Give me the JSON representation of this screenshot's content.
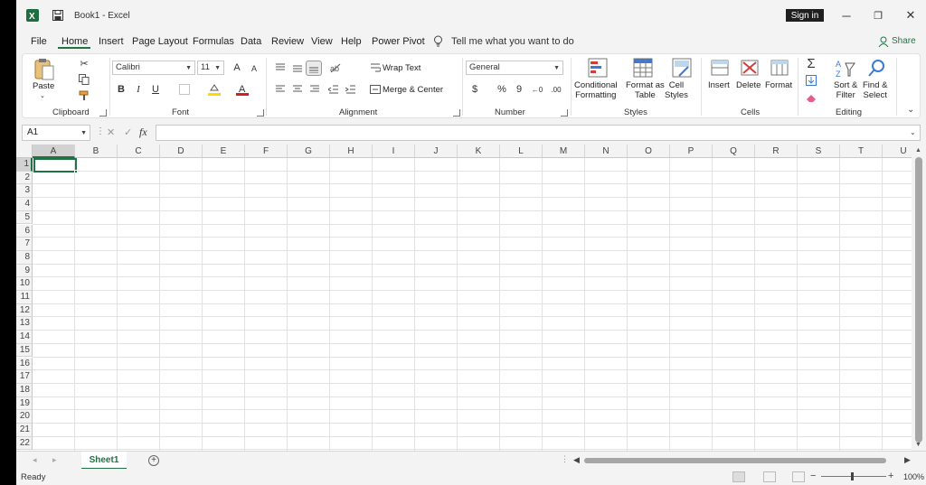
{
  "window": {
    "title": "Book1  -  Excel",
    "signin": "Sign in",
    "minimize": "─",
    "restore": "❐",
    "close": "✕"
  },
  "menu": {
    "items": [
      "File",
      "Home",
      "Insert",
      "Page Layout",
      "Formulas",
      "Data",
      "Review",
      "View",
      "Help",
      "Power Pivot"
    ],
    "tell_me": "Tell me what you want to do",
    "share": "Share"
  },
  "ribbon": {
    "clipboard": {
      "paste": "Paste",
      "label": "Clipboard"
    },
    "font": {
      "name": "Calibri",
      "size": "11",
      "bold": "B",
      "italic": "I",
      "underline": "U",
      "grow": "A",
      "shrink": "A",
      "label": "Font"
    },
    "alignment": {
      "wrap": "Wrap Text",
      "merge": "Merge & Center",
      "label": "Alignment"
    },
    "number": {
      "format": "General",
      "currency": "$",
      "percent": "%",
      "comma": "9",
      "label": "Number"
    },
    "styles": {
      "conditional1": "Conditional",
      "conditional2": "Formatting",
      "format_table1": "Format as",
      "format_table2": "Table",
      "cell_styles1": "Cell",
      "cell_styles2": "Styles",
      "label": "Styles"
    },
    "cells": {
      "insert": "Insert",
      "delete": "Delete",
      "format": "Format",
      "label": "Cells"
    },
    "editing": {
      "sort1": "Sort &",
      "sort2": "Filter",
      "find1": "Find &",
      "find2": "Select",
      "label": "Editing"
    }
  },
  "formula_bar": {
    "namebox": "A1",
    "fx": "fx",
    "cancel": "✕",
    "enter": "✓",
    "value": ""
  },
  "grid": {
    "columns": [
      "A",
      "B",
      "C",
      "D",
      "E",
      "F",
      "G",
      "H",
      "I",
      "J",
      "K",
      "L",
      "M",
      "N",
      "O",
      "P",
      "Q",
      "R",
      "S",
      "T",
      "U"
    ],
    "rows": [
      "1",
      "2",
      "3",
      "4",
      "5",
      "6",
      "7",
      "8",
      "9",
      "10",
      "11",
      "12",
      "13",
      "14",
      "15",
      "16",
      "17",
      "18",
      "19",
      "20",
      "21",
      "22"
    ],
    "selected": "A1"
  },
  "sheets": {
    "tabs": [
      "Sheet1"
    ],
    "add": "+"
  },
  "status": {
    "ready": "Ready",
    "zoom": "100%",
    "minus": "−",
    "plus": "+"
  },
  "colors": {
    "accent": "#217346",
    "excel_green": "#1d6f42",
    "signin_bg": "#1f1f1f"
  }
}
